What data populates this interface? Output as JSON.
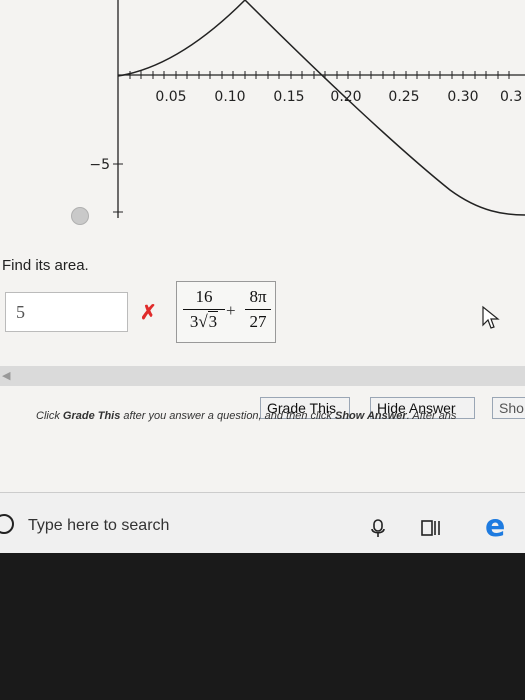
{
  "plot": {
    "x_ticks": [
      "0.05",
      "0.10",
      "0.15",
      "0.20",
      "0.25",
      "0.30",
      "0.3"
    ],
    "y_tick": "−5"
  },
  "question": {
    "prompt": "Find its area.",
    "answer_value": "5",
    "status": "incorrect",
    "correct_answer": {
      "term1_numerator": "16",
      "term1_denominator_coef": "3",
      "term1_denominator_radicand": "3",
      "operator": "+",
      "term2_numerator": "8π",
      "term2_denominator": "27"
    }
  },
  "buttons": {
    "grade": "Grade This",
    "hide_answer": "Hide Answer",
    "show": "Sho"
  },
  "instructions": {
    "part1": "Click ",
    "grade": "Grade This",
    "part2": " after you answer a question, and then click ",
    "show": "Show Answer",
    "part3": ". After ans"
  },
  "taskbar": {
    "search_placeholder": "Type here to search"
  },
  "colors": {
    "error": "#e02b2b",
    "edge": "#1e7be0"
  }
}
